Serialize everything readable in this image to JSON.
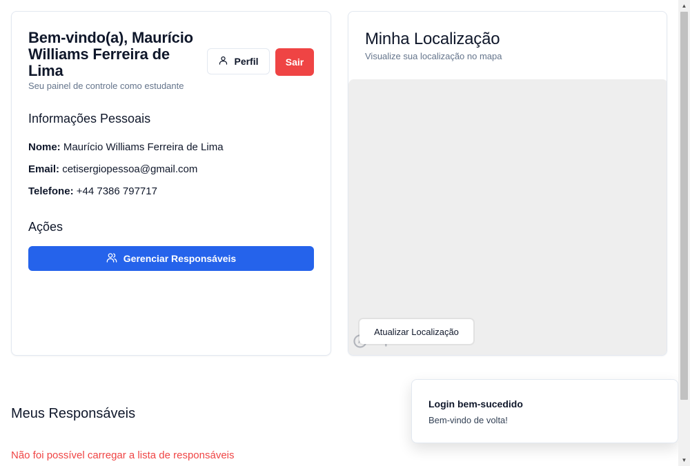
{
  "header": {
    "welcome": "Bem-vindo(a), Maurício Williams Ferreira de Lima",
    "subtitle": "Seu painel de controle como estudante",
    "profile_button": "Perfil",
    "logout_button": "Sair"
  },
  "personal_info": {
    "title": "Informações Pessoais",
    "name_label": "Nome:",
    "name_value": "Maurício Williams Ferreira de Lima",
    "email_label": "Email:",
    "email_value": "cetisergiopessoa@gmail.com",
    "phone_label": "Telefone:",
    "phone_value": "+44 7386 797717"
  },
  "actions": {
    "title": "Ações",
    "manage_button": "Gerenciar Responsáveis"
  },
  "location": {
    "title": "Minha Localização",
    "subtitle": "Visualize sua localização no mapa",
    "update_button": "Atualizar Localização",
    "map_attribution": "mapbox"
  },
  "guardians": {
    "title": "Meus Responsáveis",
    "error": "Não foi possível carregar a lista de responsáveis"
  },
  "toast": {
    "title": "Login bem-sucedido",
    "description": "Bem-vindo de volta!"
  },
  "colors": {
    "primary": "#2563eb",
    "danger": "#ef4444",
    "muted": "#64748b",
    "map_background": "#eeeeee"
  },
  "icons": {
    "profile": "user-icon",
    "manage": "users-icon",
    "map_logo": "mapbox-logo"
  }
}
